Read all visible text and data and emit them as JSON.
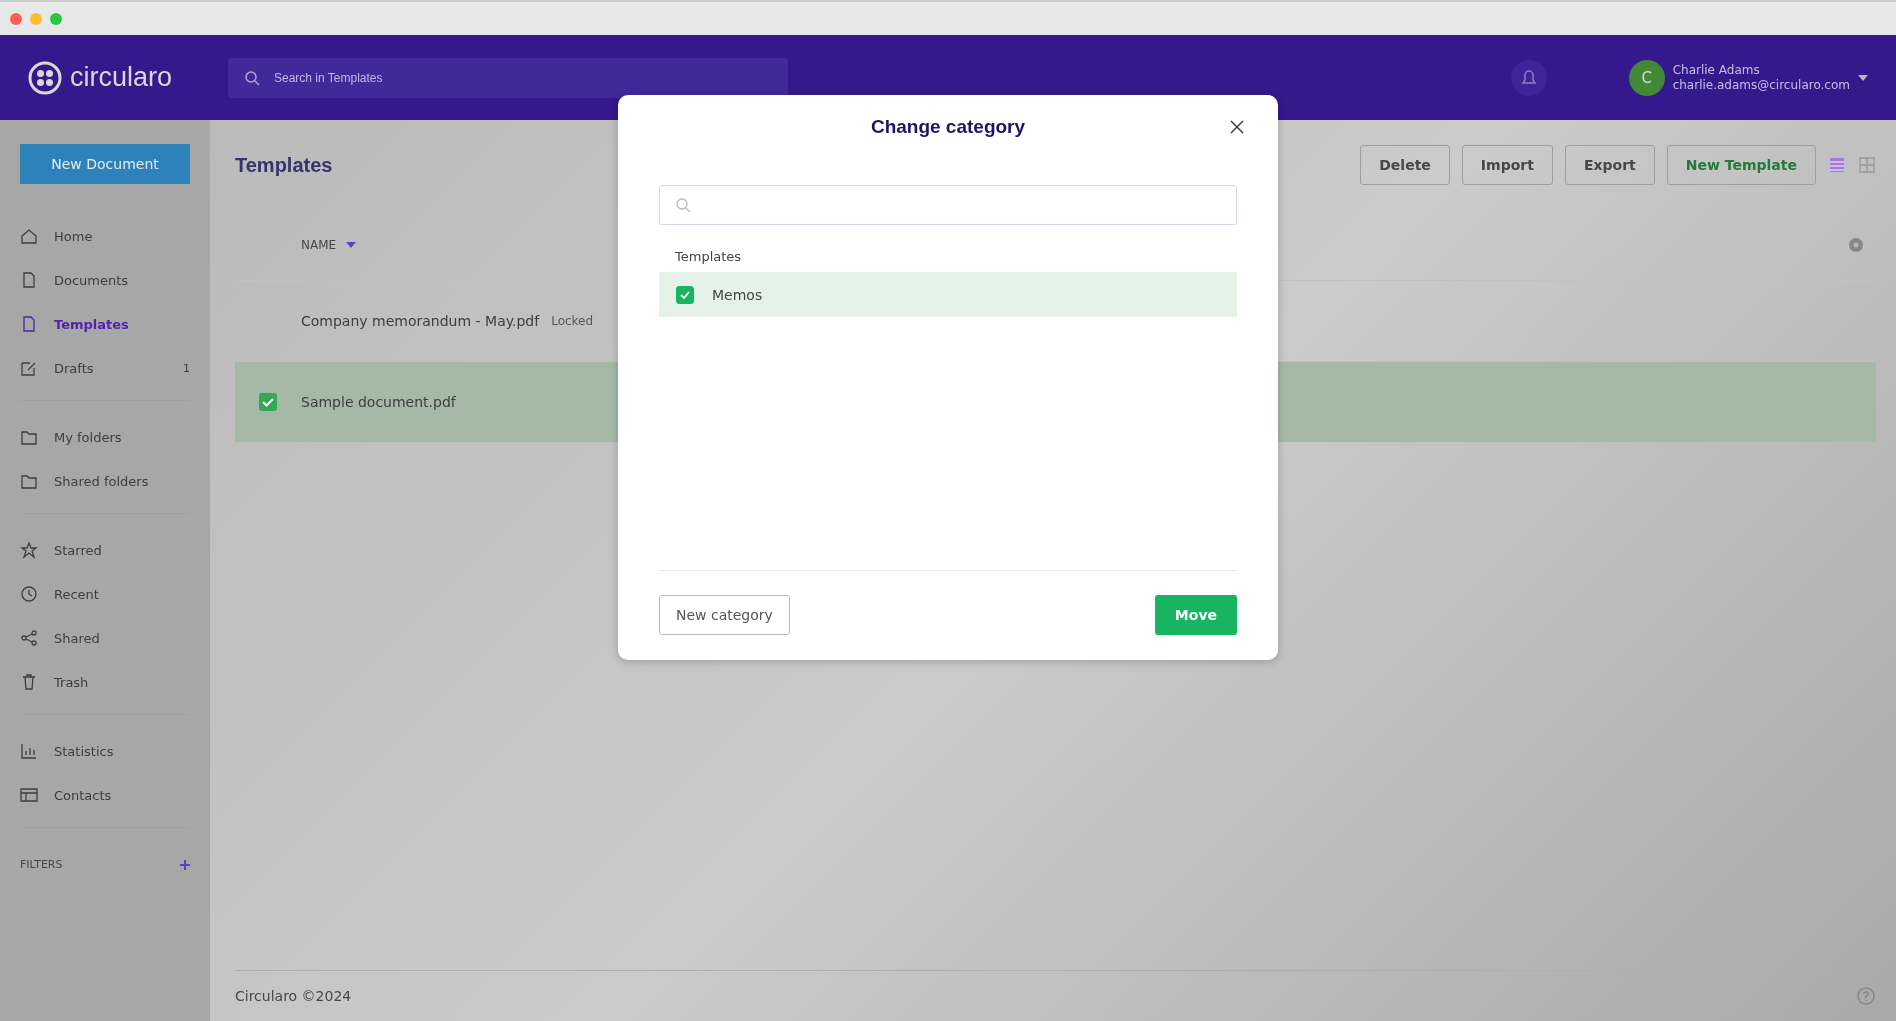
{
  "app": {
    "logo": "circularo",
    "search": {
      "placeholder": "Search in Templates"
    },
    "user": {
      "initial": "C",
      "name": "Charlie Adams",
      "email": "charlie.adams@circularo.com"
    }
  },
  "sidebar": {
    "new_button": "New Document",
    "groups": [
      [
        {
          "label": "Home",
          "selected": false
        },
        {
          "label": "Documents",
          "selected": false
        },
        {
          "label": "Templates",
          "selected": true
        },
        {
          "label": "Drafts",
          "selected": false,
          "count": "1"
        }
      ],
      [
        {
          "label": "My folders",
          "selected": false
        },
        {
          "label": "Shared folders",
          "selected": false
        }
      ],
      [
        {
          "label": "Starred",
          "selected": false
        },
        {
          "label": "Recent",
          "selected": false
        },
        {
          "label": "Shared",
          "selected": false
        },
        {
          "label": "Trash",
          "selected": false
        }
      ],
      [
        {
          "label": "Statistics",
          "selected": false
        },
        {
          "label": "Contacts",
          "selected": false
        }
      ]
    ],
    "filters_label": "FILTERS"
  },
  "page": {
    "title": "Templates",
    "toolbar": [
      {
        "label": "Delete",
        "kind": "plain"
      },
      {
        "label": "Import",
        "kind": "plain"
      },
      {
        "label": "Export",
        "kind": "plain"
      },
      {
        "label": "New Template",
        "kind": "primary"
      }
    ],
    "table": {
      "columns": [
        "NAME"
      ],
      "rows": [
        {
          "name": "Company memorandum - May.pdf",
          "tag": "Locked",
          "selected": false
        },
        {
          "name": "Sample document.pdf",
          "selected": true
        }
      ]
    },
    "footer": "Circularo ©2024"
  },
  "dialog": {
    "title": "Change category",
    "section": "Templates",
    "items": [
      {
        "label": "Memos",
        "checked": true
      }
    ],
    "buttons": [
      {
        "label": "New category",
        "kind": "secondary"
      },
      {
        "label": "Move",
        "kind": "primary"
      }
    ]
  }
}
